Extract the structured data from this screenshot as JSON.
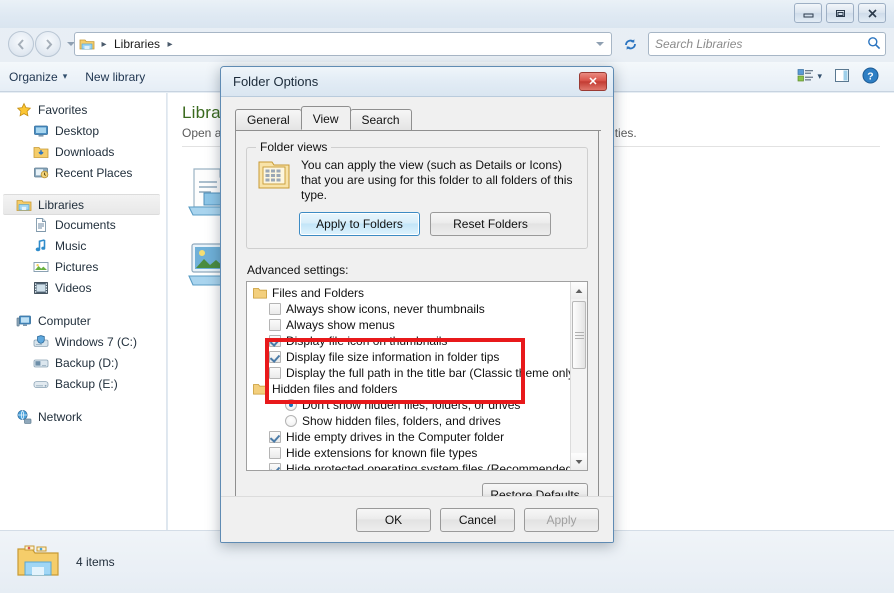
{
  "window": {
    "controls": [
      {
        "name": "minimize",
        "label": "Minimize"
      },
      {
        "name": "restore",
        "label": "Restore"
      },
      {
        "name": "close",
        "label": "Close"
      }
    ]
  },
  "address": {
    "breadcrumb_root_icon": "libraries-folder-icon",
    "crumb": "Libraries",
    "sep": "▸",
    "dropdown_icon": "chevron-down-icon",
    "refresh_icon": "refresh-icon",
    "back_icon": "back-arrow-icon",
    "forward_icon": "forward-arrow-icon",
    "history_icon": "history-dropdown-icon"
  },
  "search": {
    "placeholder": "Search Libraries",
    "icon": "search-icon"
  },
  "toolbar": {
    "organize": "Organize",
    "organize_caret": "▾",
    "new_library": "New library",
    "view_icon": "view-layout-icon",
    "view_caret": "▾",
    "preview_icon": "preview-pane-icon",
    "help_icon": "help-icon",
    "help_glyph": "?"
  },
  "sidebar": {
    "groups": [
      {
        "header": {
          "label": "Favorites",
          "icon": "star-icon"
        },
        "items": [
          {
            "label": "Desktop",
            "icon": "desktop-icon"
          },
          {
            "label": "Downloads",
            "icon": "downloads-icon"
          },
          {
            "label": "Recent Places",
            "icon": "recent-places-icon"
          }
        ]
      },
      {
        "header": {
          "label": "Libraries",
          "icon": "libraries-icon",
          "selected": true
        },
        "items": [
          {
            "label": "Documents",
            "icon": "documents-icon"
          },
          {
            "label": "Music",
            "icon": "music-icon"
          },
          {
            "label": "Pictures",
            "icon": "pictures-icon"
          },
          {
            "label": "Videos",
            "icon": "videos-icon"
          }
        ]
      },
      {
        "header": {
          "label": "Computer",
          "icon": "computer-icon"
        },
        "items": [
          {
            "label": "Windows 7 (C:)",
            "icon": "system-drive-icon"
          },
          {
            "label": "Backup (D:)",
            "icon": "drive-icon"
          },
          {
            "label": "Backup (E:)",
            "icon": "drive-icon"
          }
        ]
      },
      {
        "header": {
          "label": "Network",
          "icon": "network-icon"
        },
        "items": []
      }
    ]
  },
  "content": {
    "title": "Libraries",
    "subtitle_visible_head": "Open a",
    "subtitle_visible_tail": "ties."
  },
  "status": {
    "icon": "libraries-folder-icon",
    "items_count": "4 items"
  },
  "dialog": {
    "title": "Folder Options",
    "close_glyph": "✕",
    "tabs": [
      {
        "label": "General",
        "active": false
      },
      {
        "label": "View",
        "active": true
      },
      {
        "label": "Search",
        "active": false
      }
    ],
    "folder_views": {
      "legend": "Folder views",
      "icon": "folder-views-icon",
      "description": "You can apply the view (such as Details or Icons) that you are using for this folder to all folders of this type.",
      "apply_to_folders": "Apply to Folders",
      "reset_folders": "Reset Folders"
    },
    "advanced_label": "Advanced settings:",
    "advanced_items": [
      {
        "type": "group",
        "label": "Files and Folders",
        "icon": "folder-icon"
      },
      {
        "type": "checkbox",
        "label": "Always show icons, never thumbnails",
        "checked": false
      },
      {
        "type": "checkbox",
        "label": "Always show menus",
        "checked": false
      },
      {
        "type": "checkbox",
        "label": "Display file icon on thumbnails",
        "checked": true
      },
      {
        "type": "checkbox",
        "label": "Display file size information in folder tips",
        "checked": true
      },
      {
        "type": "checkbox",
        "label": "Display the full path in the title bar (Classic theme only)",
        "checked": false
      },
      {
        "type": "group",
        "label": "Hidden files and folders",
        "icon": "folder-icon"
      },
      {
        "type": "radio",
        "label": "Don't show hidden files, folders, or drives",
        "selected": true
      },
      {
        "type": "radio",
        "label": "Show hidden files, folders, and drives",
        "selected": false
      },
      {
        "type": "checkbox",
        "label": "Hide empty drives in the Computer folder",
        "checked": true
      },
      {
        "type": "checkbox",
        "label": "Hide extensions for known file types",
        "checked": false
      },
      {
        "type": "checkbox",
        "label": "Hide protected operating system files (Recommended)",
        "checked": true
      }
    ],
    "restore_defaults": "Restore Defaults",
    "footer": {
      "ok": "OK",
      "cancel": "Cancel",
      "apply": "Apply",
      "apply_disabled": true
    }
  },
  "annotation": {
    "highlight_color": "#e8191b",
    "target": "Hidden files and folders"
  }
}
